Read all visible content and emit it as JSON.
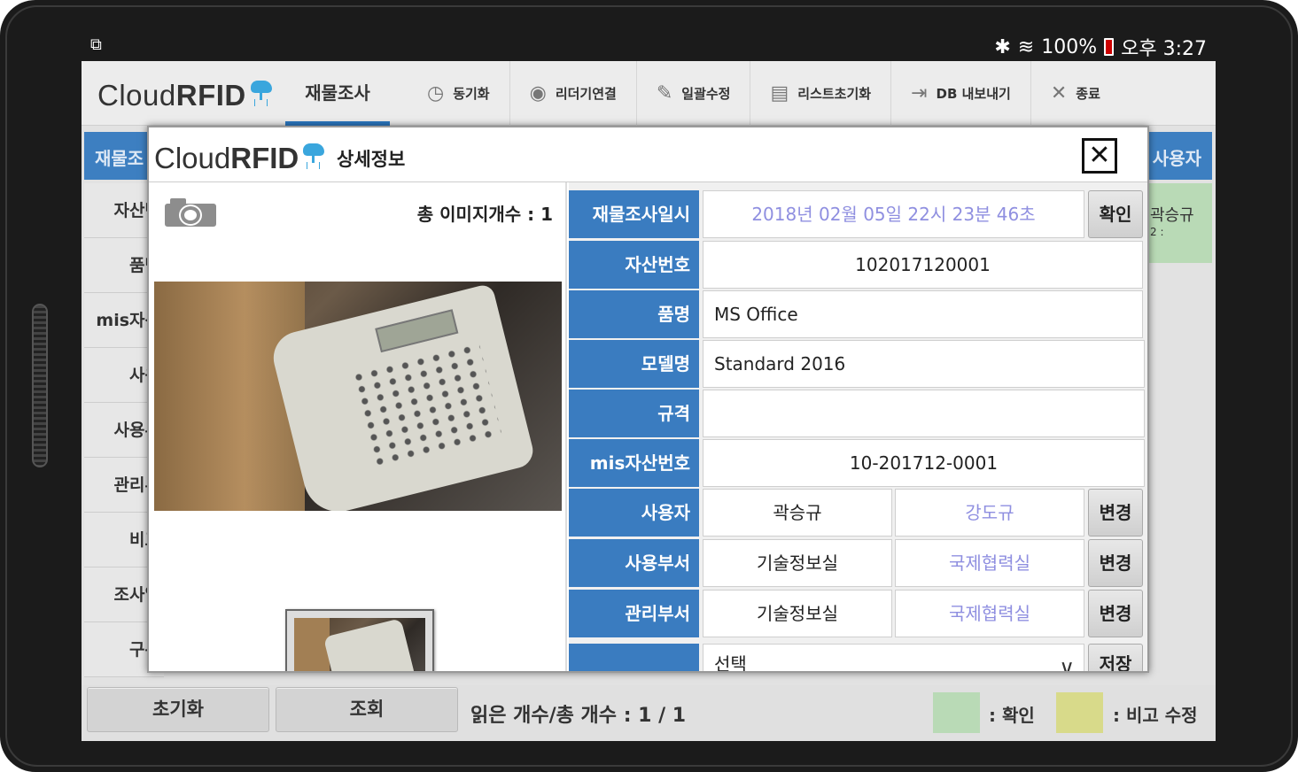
{
  "status_bar": {
    "battery": "100%",
    "time": "오후 3:27"
  },
  "app": {
    "logo_light": "Cloud",
    "logo_bold": "RFID",
    "active_tab": "재물조사",
    "menu": [
      {
        "icon": "clock-icon",
        "glyph": "◷",
        "label": "동기화"
      },
      {
        "icon": "eye-icon",
        "glyph": "◉",
        "label": "리더기연결"
      },
      {
        "icon": "pencil-icon",
        "glyph": "✎",
        "label": "일괄수정"
      },
      {
        "icon": "list-reset-icon",
        "glyph": "▤",
        "label": "리스트초기화"
      },
      {
        "icon": "export-icon",
        "glyph": "⇥",
        "label": "DB 내보내기"
      },
      {
        "icon": "close-x-icon",
        "glyph": "✕",
        "label": "종료"
      }
    ]
  },
  "background": {
    "header_left": "재물조",
    "header_right": "사용자",
    "labels": [
      "자산번",
      "품명",
      "mis자산",
      "사용",
      "사용부",
      "관리부",
      "비고",
      "조사일",
      "구분"
    ],
    "green_text": "곽승규",
    "green_sub": "2 :",
    "reset_button": "초기화",
    "search_button": "조회",
    "read_count": "읽은 개수/총 개수 : 1 / 1",
    "legend_confirm": ":  확인",
    "legend_note": ": 비고 수정",
    "legend_green": "#b9dab6",
    "legend_yellow": "#d8da8a"
  },
  "modal": {
    "title": "상세정보",
    "image_count": "총 이미지개수 : 1",
    "rows": {
      "survey_date": {
        "label": "재물조사일시",
        "value": "2018년 02월 05일 22시 23분 46초",
        "button": "확인"
      },
      "asset_no": {
        "label": "자산번호",
        "value": "102017120001"
      },
      "item_name": {
        "label": "품명",
        "value": "MS Office"
      },
      "model_name": {
        "label": "모델명",
        "value": "Standard 2016"
      },
      "spec": {
        "label": "규격",
        "value": ""
      },
      "mis_asset_no": {
        "label": "mis자산번호",
        "value": "10-201712-0001"
      },
      "user": {
        "label": "사용자",
        "current": "곽승규",
        "new": "강도규",
        "button": "변경"
      },
      "user_dept": {
        "label": "사용부서",
        "current": "기술정보실",
        "new": "국제협력실",
        "button": "변경"
      },
      "mgmt_dept": {
        "label": "관리부서",
        "current": "기술정보실",
        "new": "국제협력실",
        "button": "변경"
      },
      "select_row": {
        "label": "",
        "value": "선택",
        "button": "저장"
      }
    }
  },
  "colors": {
    "primary_blue": "#3a7cc0",
    "accent_purple": "#8f8fe0"
  }
}
